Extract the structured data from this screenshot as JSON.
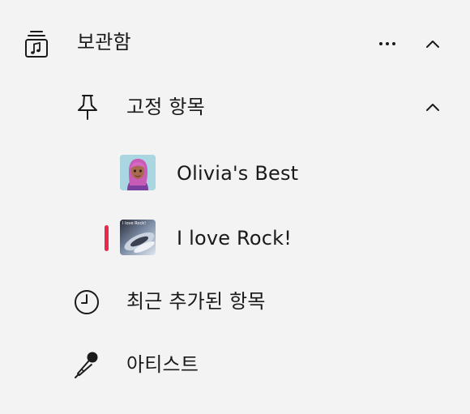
{
  "library": {
    "title": "보관함",
    "icon": "music-library-icon",
    "more_icon": "more-icon",
    "chevron_icon": "chevron-up-icon"
  },
  "pinned": {
    "title": "고정 항목",
    "icon": "pin-icon",
    "chevron_icon": "chevron-up-icon",
    "items": [
      {
        "label": "Olivia's Best",
        "thumb_icon": "avatar-thumbnail",
        "selected": false
      },
      {
        "label": "I love Rock!",
        "thumb_icon": "playlist-thumbnail",
        "thumb_caption": "I love Rock!",
        "selected": true
      }
    ]
  },
  "nav": [
    {
      "label": "최근 추가된 항목",
      "icon": "clock-icon"
    },
    {
      "label": "아티스트",
      "icon": "microphone-icon"
    }
  ],
  "colors": {
    "background": "#f3f3f3",
    "text": "#1a1a1a",
    "accent": "#e8294b"
  }
}
